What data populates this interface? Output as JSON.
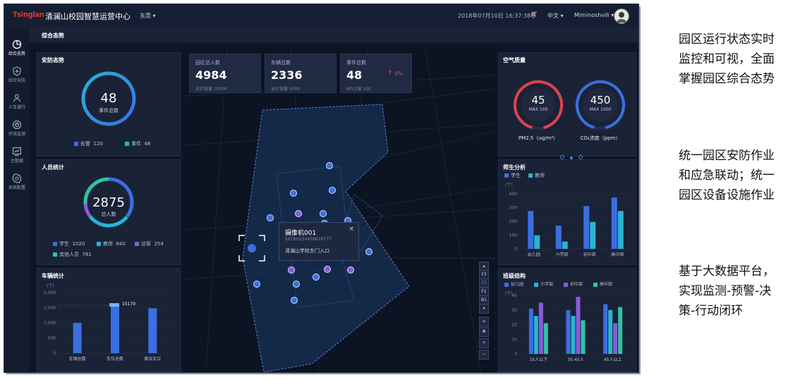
{
  "topbar": {
    "logo": "Tsinglan",
    "title": "清澜山校园智慧运营中心",
    "city": "东莞",
    "datetime": "2018年07月10日 16:37:38",
    "language": "中文",
    "username": "Miminoshvili"
  },
  "sidebar": {
    "items": [
      {
        "label": "综合态势",
        "icon": "dashboard-icon"
      },
      {
        "label": "综合安防",
        "icon": "shield-icon"
      },
      {
        "label": "人车通行",
        "icon": "person-icon"
      },
      {
        "label": "环境监测",
        "icon": "environment-icon"
      },
      {
        "label": "主数据",
        "icon": "chart-icon"
      },
      {
        "label": "系统配置",
        "icon": "gear-icon"
      }
    ]
  },
  "subheader": {
    "title": "综合态势"
  },
  "security": {
    "title": "安防态势",
    "total": "48",
    "total_label": "事件总数",
    "legend": [
      {
        "label": "告警",
        "value": "120",
        "color": "#3b6fe0"
      },
      {
        "label": "事件",
        "value": "48",
        "color": "#2ab3d6"
      }
    ]
  },
  "personnel": {
    "title": "人员统计",
    "total": "2875",
    "total_label": "总人数",
    "legend": [
      {
        "label": "学生",
        "value": "1020",
        "color": "#3b6fe0"
      },
      {
        "label": "教师",
        "value": "840",
        "color": "#2ab3d6"
      },
      {
        "label": "访客",
        "value": "254",
        "color": "#8b5bd6"
      },
      {
        "label": "其他人员",
        "value": "761",
        "color": "#30c2a6"
      }
    ]
  },
  "vehicles": {
    "title": "车辆统计",
    "unit": "(个)",
    "peak_label": "15170",
    "chart_data": {
      "type": "bar",
      "categories": [
        "车辆总数",
        "车位总数",
        "剩余车位"
      ],
      "values": [
        1000,
        1600,
        1480
      ],
      "yticks": [
        "0",
        "500",
        "1,000",
        "1,500",
        "2,000"
      ],
      "ylim": [
        0,
        2000
      ]
    }
  },
  "stats": [
    {
      "label": "园区总人数",
      "value": "4984",
      "sub": "设计容量  10000"
    },
    {
      "label": "车辆总数",
      "value": "2336",
      "sub": "设计容量  5000"
    },
    {
      "label": "事件总数",
      "value": "48",
      "sub": "KPI上限  100",
      "trend": "9%"
    }
  ],
  "map": {
    "popup": {
      "title": "摄像机001",
      "code": "SXTBH234456676777",
      "location": "清澜山学校东门入口"
    },
    "floors": [
      "F3",
      "F2",
      "F1",
      "B1"
    ]
  },
  "air": {
    "title": "空气质量",
    "gauges": [
      {
        "value": "45",
        "max_label": "MAX 100",
        "label": "PM2.5（ug/m³）",
        "color": "#e0414f",
        "fraction": 0.45
      },
      {
        "value": "450",
        "max_label": "MAX 1000",
        "label": "CO₂浓度（ppm）",
        "color": "#3b6fe0",
        "fraction": 0.45
      }
    ]
  },
  "teacher_student": {
    "title": "师生分析",
    "unit": "(个)",
    "chart_data": {
      "type": "bar",
      "categories": [
        "幼儿园",
        "小学部",
        "初中部",
        "高中部"
      ],
      "series": [
        {
          "name": "学生",
          "values": [
            310,
            190,
            350,
            420
          ],
          "color": "#3b6fe0"
        },
        {
          "name": "教师",
          "values": [
            110,
            60,
            220,
            310
          ],
          "color": "#2ab3d6"
        }
      ],
      "yticks": [
        "0",
        "100",
        "200",
        "300",
        "400"
      ],
      "ylim": [
        0,
        450
      ]
    }
  },
  "class_structure": {
    "title": "班级结构",
    "unit": "(个)",
    "chart_data": {
      "type": "bar",
      "categories": [
        "35人以下",
        "35-45人",
        "45人以上"
      ],
      "series": [
        {
          "name": "幼儿园",
          "values": [
            31,
            30,
            34
          ],
          "color": "#3b6fe0"
        },
        {
          "name": "小学部",
          "values": [
            26,
            26,
            30
          ],
          "color": "#2ab3d6"
        },
        {
          "name": "初中部",
          "values": [
            35,
            39,
            21
          ],
          "color": "#8b5bd6"
        },
        {
          "name": "高中部",
          "values": [
            21,
            23,
            32
          ],
          "color": "#30c2a6"
        }
      ],
      "yticks": [
        "0",
        "10",
        "20",
        "30",
        "40"
      ],
      "ylim": [
        0,
        40
      ]
    }
  },
  "captions": [
    {
      "lines": [
        "园区运行状态实时",
        "监控和可视，全面",
        "掌握园区综合态势"
      ]
    },
    {
      "lines": [
        "统一园区安防作业",
        "和应急联动；统一",
        "园区设备设施作业"
      ]
    },
    {
      "lines": [
        "基于大数据平台，",
        "实现监测-预警-决",
        "策-行动闭环"
      ]
    }
  ]
}
